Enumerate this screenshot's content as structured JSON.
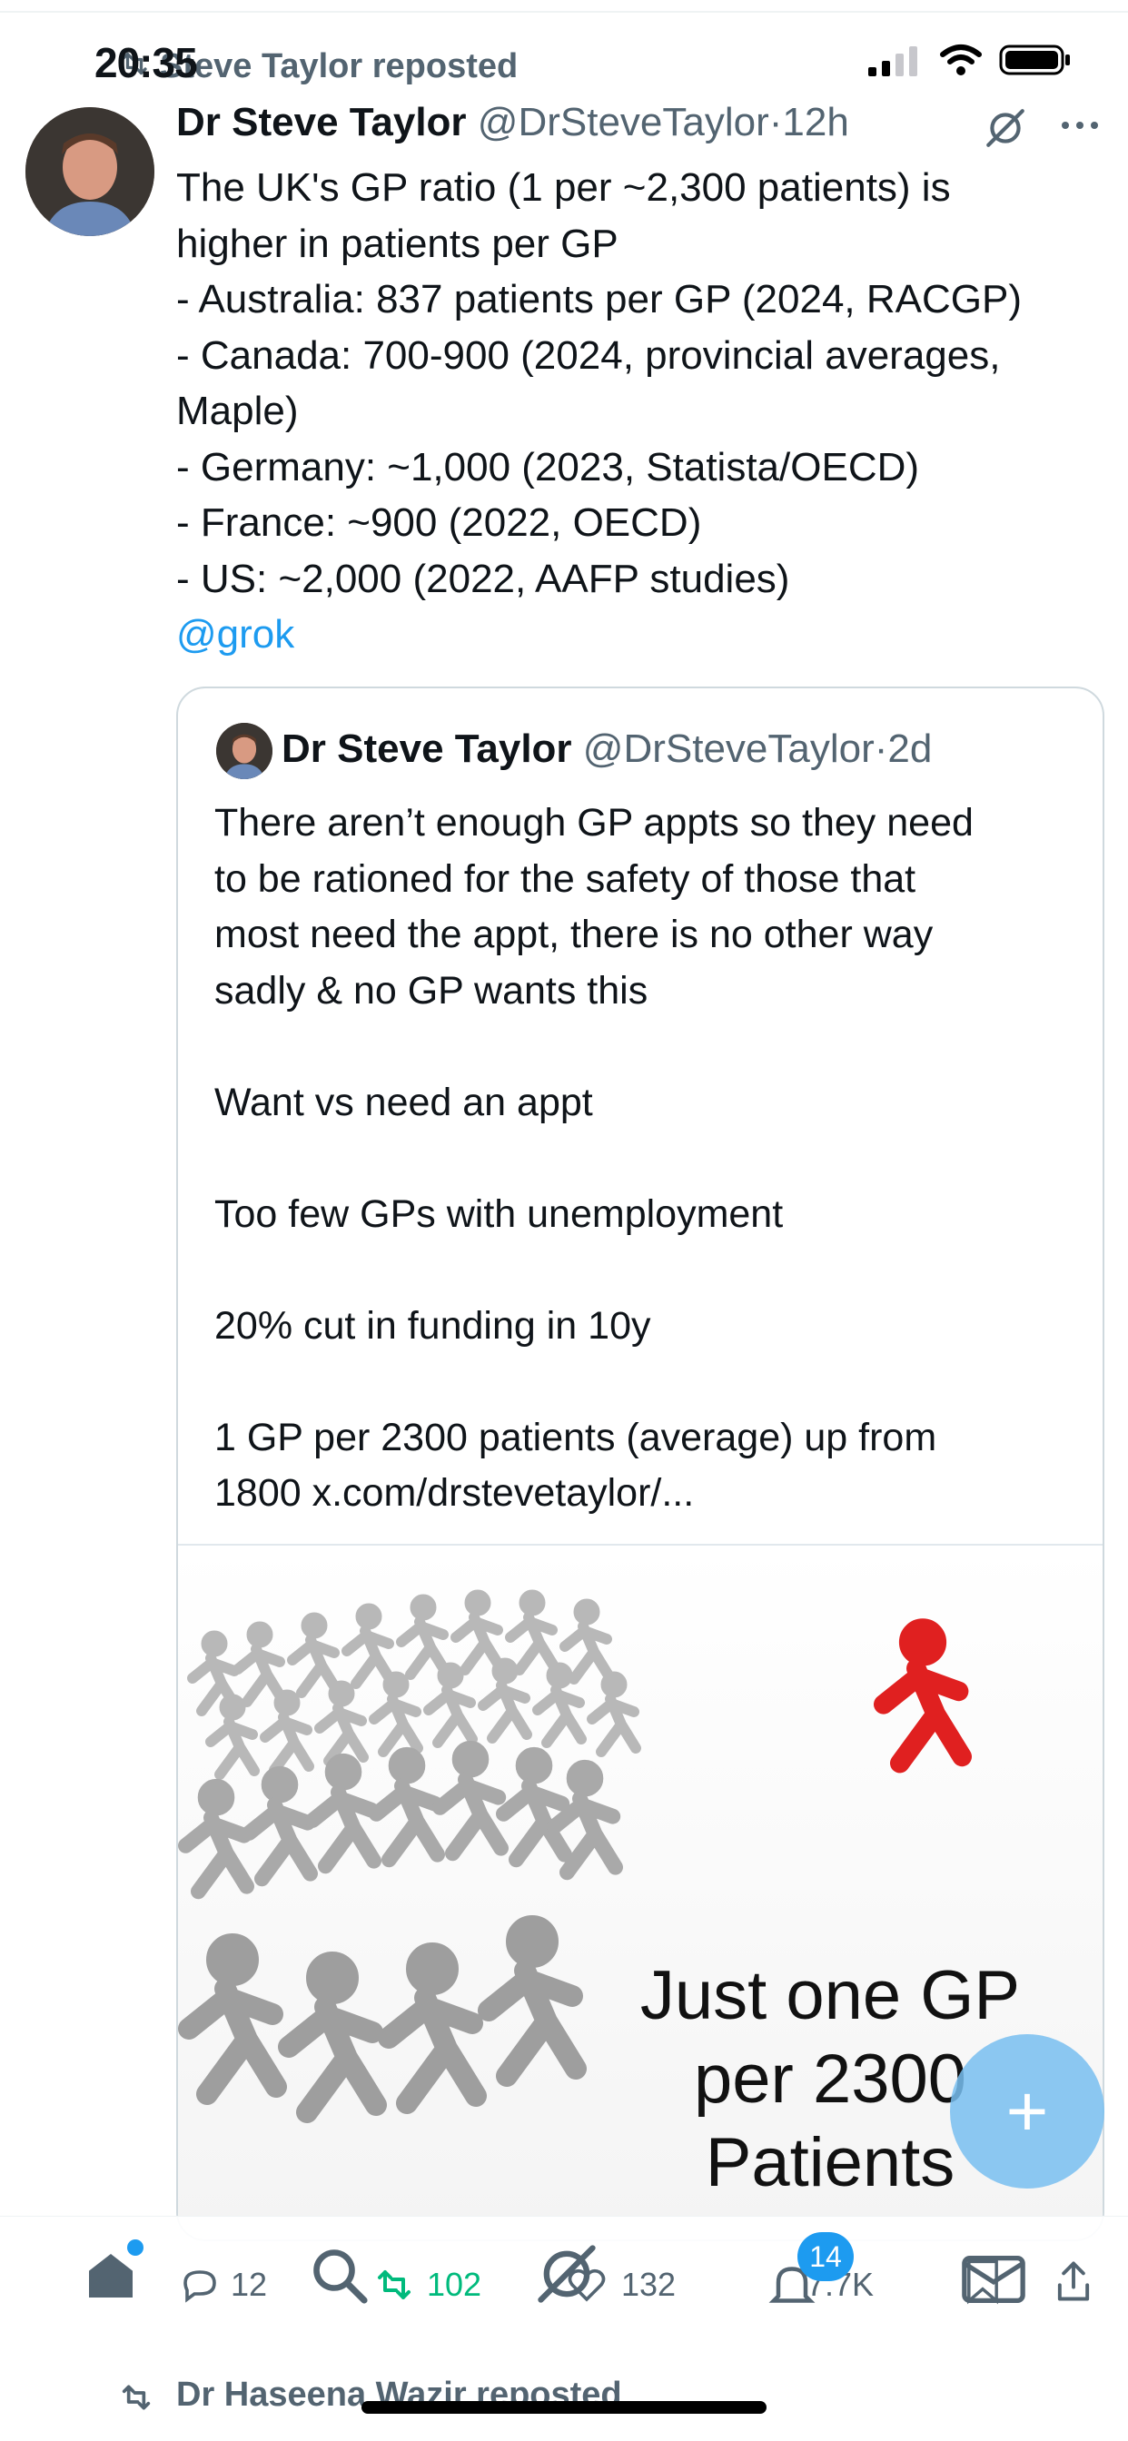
{
  "status_bar": {
    "time": "20:35"
  },
  "repost_banner": {
    "text": "Steve Taylor reposted"
  },
  "tweet": {
    "author_name": "Dr Steve Taylor",
    "handle": "@DrSteveTaylor",
    "separator": "·",
    "age": "12h",
    "lines": [
      "The UK's GP ratio (1 per ~2,300 patients) is",
      "higher in patients per GP",
      "- Australia: 837 patients per GP (2024, RACGP)",
      "- Canada: 700-900 (2024, provincial averages,",
      "Maple)",
      "- Germany: ~1,000 (2023, Statista/OECD)",
      "- France: ~900 (2022, OECD)",
      "- US: ~2,000 (2022, AAFP studies)"
    ],
    "mention": "@grok"
  },
  "quote": {
    "author_name": "Dr Steve Taylor",
    "handle": "@DrSteveTaylor",
    "separator": "·",
    "age": "2d",
    "lines": [
      "There aren’t enough GP appts so they need",
      "to be rationed for the safety of those that",
      "most need the appt, there is no other way",
      "sadly & no GP wants this",
      "",
      "Want vs need an appt",
      "",
      "Too few GPs with unemployment",
      "",
      "20% cut in funding in 10y",
      "",
      "1 GP per 2300 patients (average) up from",
      "1800 x.com/drstevetaylor/..."
    ],
    "image_caption": [
      "Just one GP",
      "per 2300",
      "Patients"
    ]
  },
  "actions": {
    "replies": "12",
    "reposts": "102",
    "likes": "132",
    "views": "7.7K"
  },
  "tabbar": {
    "notifications_badge": "14"
  },
  "next_item": {
    "repost_text": "Dr Haseena Wazir reposted"
  },
  "colors": {
    "accent": "#1d9bf0",
    "repost_green": "#00ba7c",
    "muted": "#536471"
  }
}
